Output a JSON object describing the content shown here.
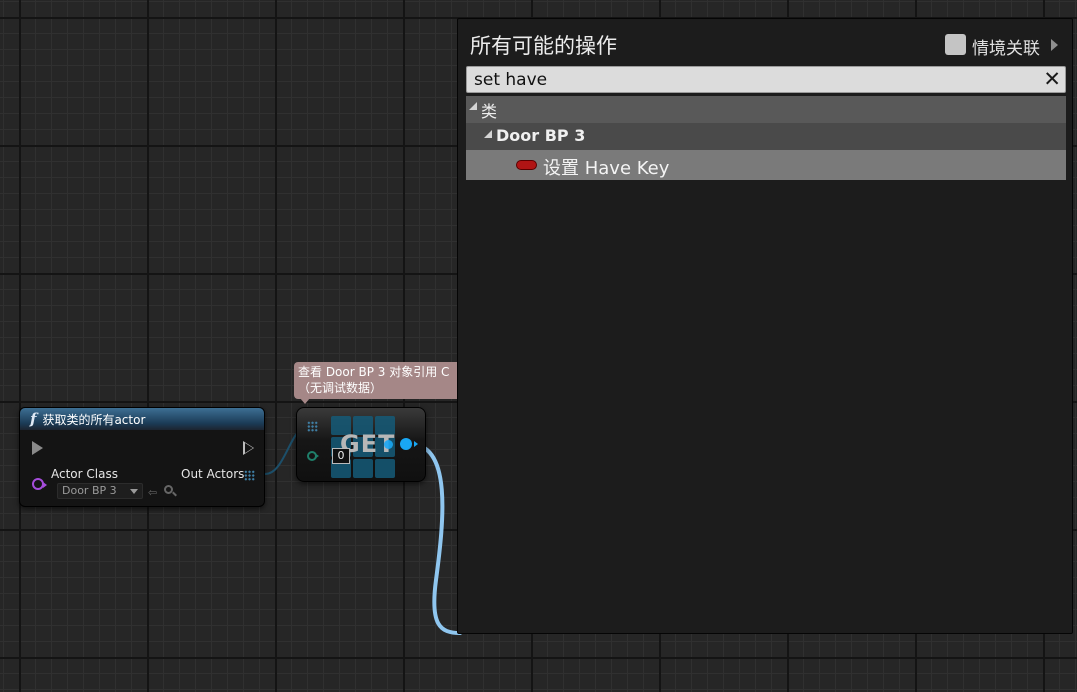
{
  "function_node": {
    "title": "获取类的所有actor",
    "actor_class_label": "Actor Class",
    "out_actors_label": "Out Actors",
    "class_value": "Door BP 3"
  },
  "tooltip": {
    "line1": "查看 Door BP 3 对象引用 C",
    "line2": "（无调试数据）"
  },
  "get_node": {
    "label": "GET",
    "index": "0"
  },
  "menu": {
    "title": "所有可能的操作",
    "context_label": "情境关联",
    "search_value": "set have",
    "category": "类",
    "subcategory": "Door BP 3",
    "item": "设置 Have Key"
  },
  "colors": {
    "object_pin": "#19a7f3",
    "variable_pill": "#b01414",
    "class_pin": "#a54ddb"
  }
}
